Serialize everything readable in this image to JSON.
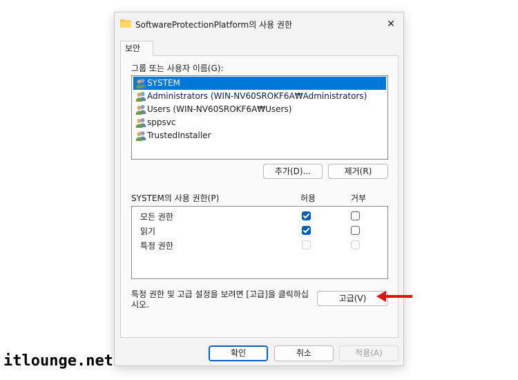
{
  "window": {
    "title": "SoftwareProtectionPlatform의 사용 권한",
    "close_label": "✕"
  },
  "tabs": [
    {
      "label": "보안"
    }
  ],
  "users": {
    "label": "그룹 또는 사용자 이름(G):",
    "items": [
      {
        "name": "SYSTEM",
        "selected": true
      },
      {
        "name": "Administrators (WIN-NV60SROKF6A₩Administrators)",
        "selected": false
      },
      {
        "name": "Users (WIN-NV60SROKF6A₩Users)",
        "selected": false
      },
      {
        "name": "sppsvc",
        "selected": false
      },
      {
        "name": "TrustedInstaller",
        "selected": false
      }
    ],
    "add_label": "추가(D)...",
    "remove_label": "제거(R)"
  },
  "permissions": {
    "label": "SYSTEM의 사용 권한(P)",
    "allow_header": "허용",
    "deny_header": "거부",
    "rows": [
      {
        "name": "모든 권한",
        "allow": "checked",
        "deny": "unchecked"
      },
      {
        "name": "읽기",
        "allow": "checked",
        "deny": "unchecked"
      },
      {
        "name": "특정 권한",
        "allow": "disabled",
        "deny": "disabled"
      }
    ]
  },
  "advanced": {
    "info": "특정 권한 및 고급 설정을 보려면 [고급]을 클릭하십시오.",
    "button_label": "고급(V)"
  },
  "footer": {
    "ok_label": "확인",
    "cancel_label": "취소",
    "apply_label": "적용(A)"
  },
  "watermark": "itlounge.net",
  "colors": {
    "selection": "#0078d7",
    "checkbox_checked": "#005fb8",
    "arrow": "#e01010",
    "folder": "#f5c242"
  }
}
